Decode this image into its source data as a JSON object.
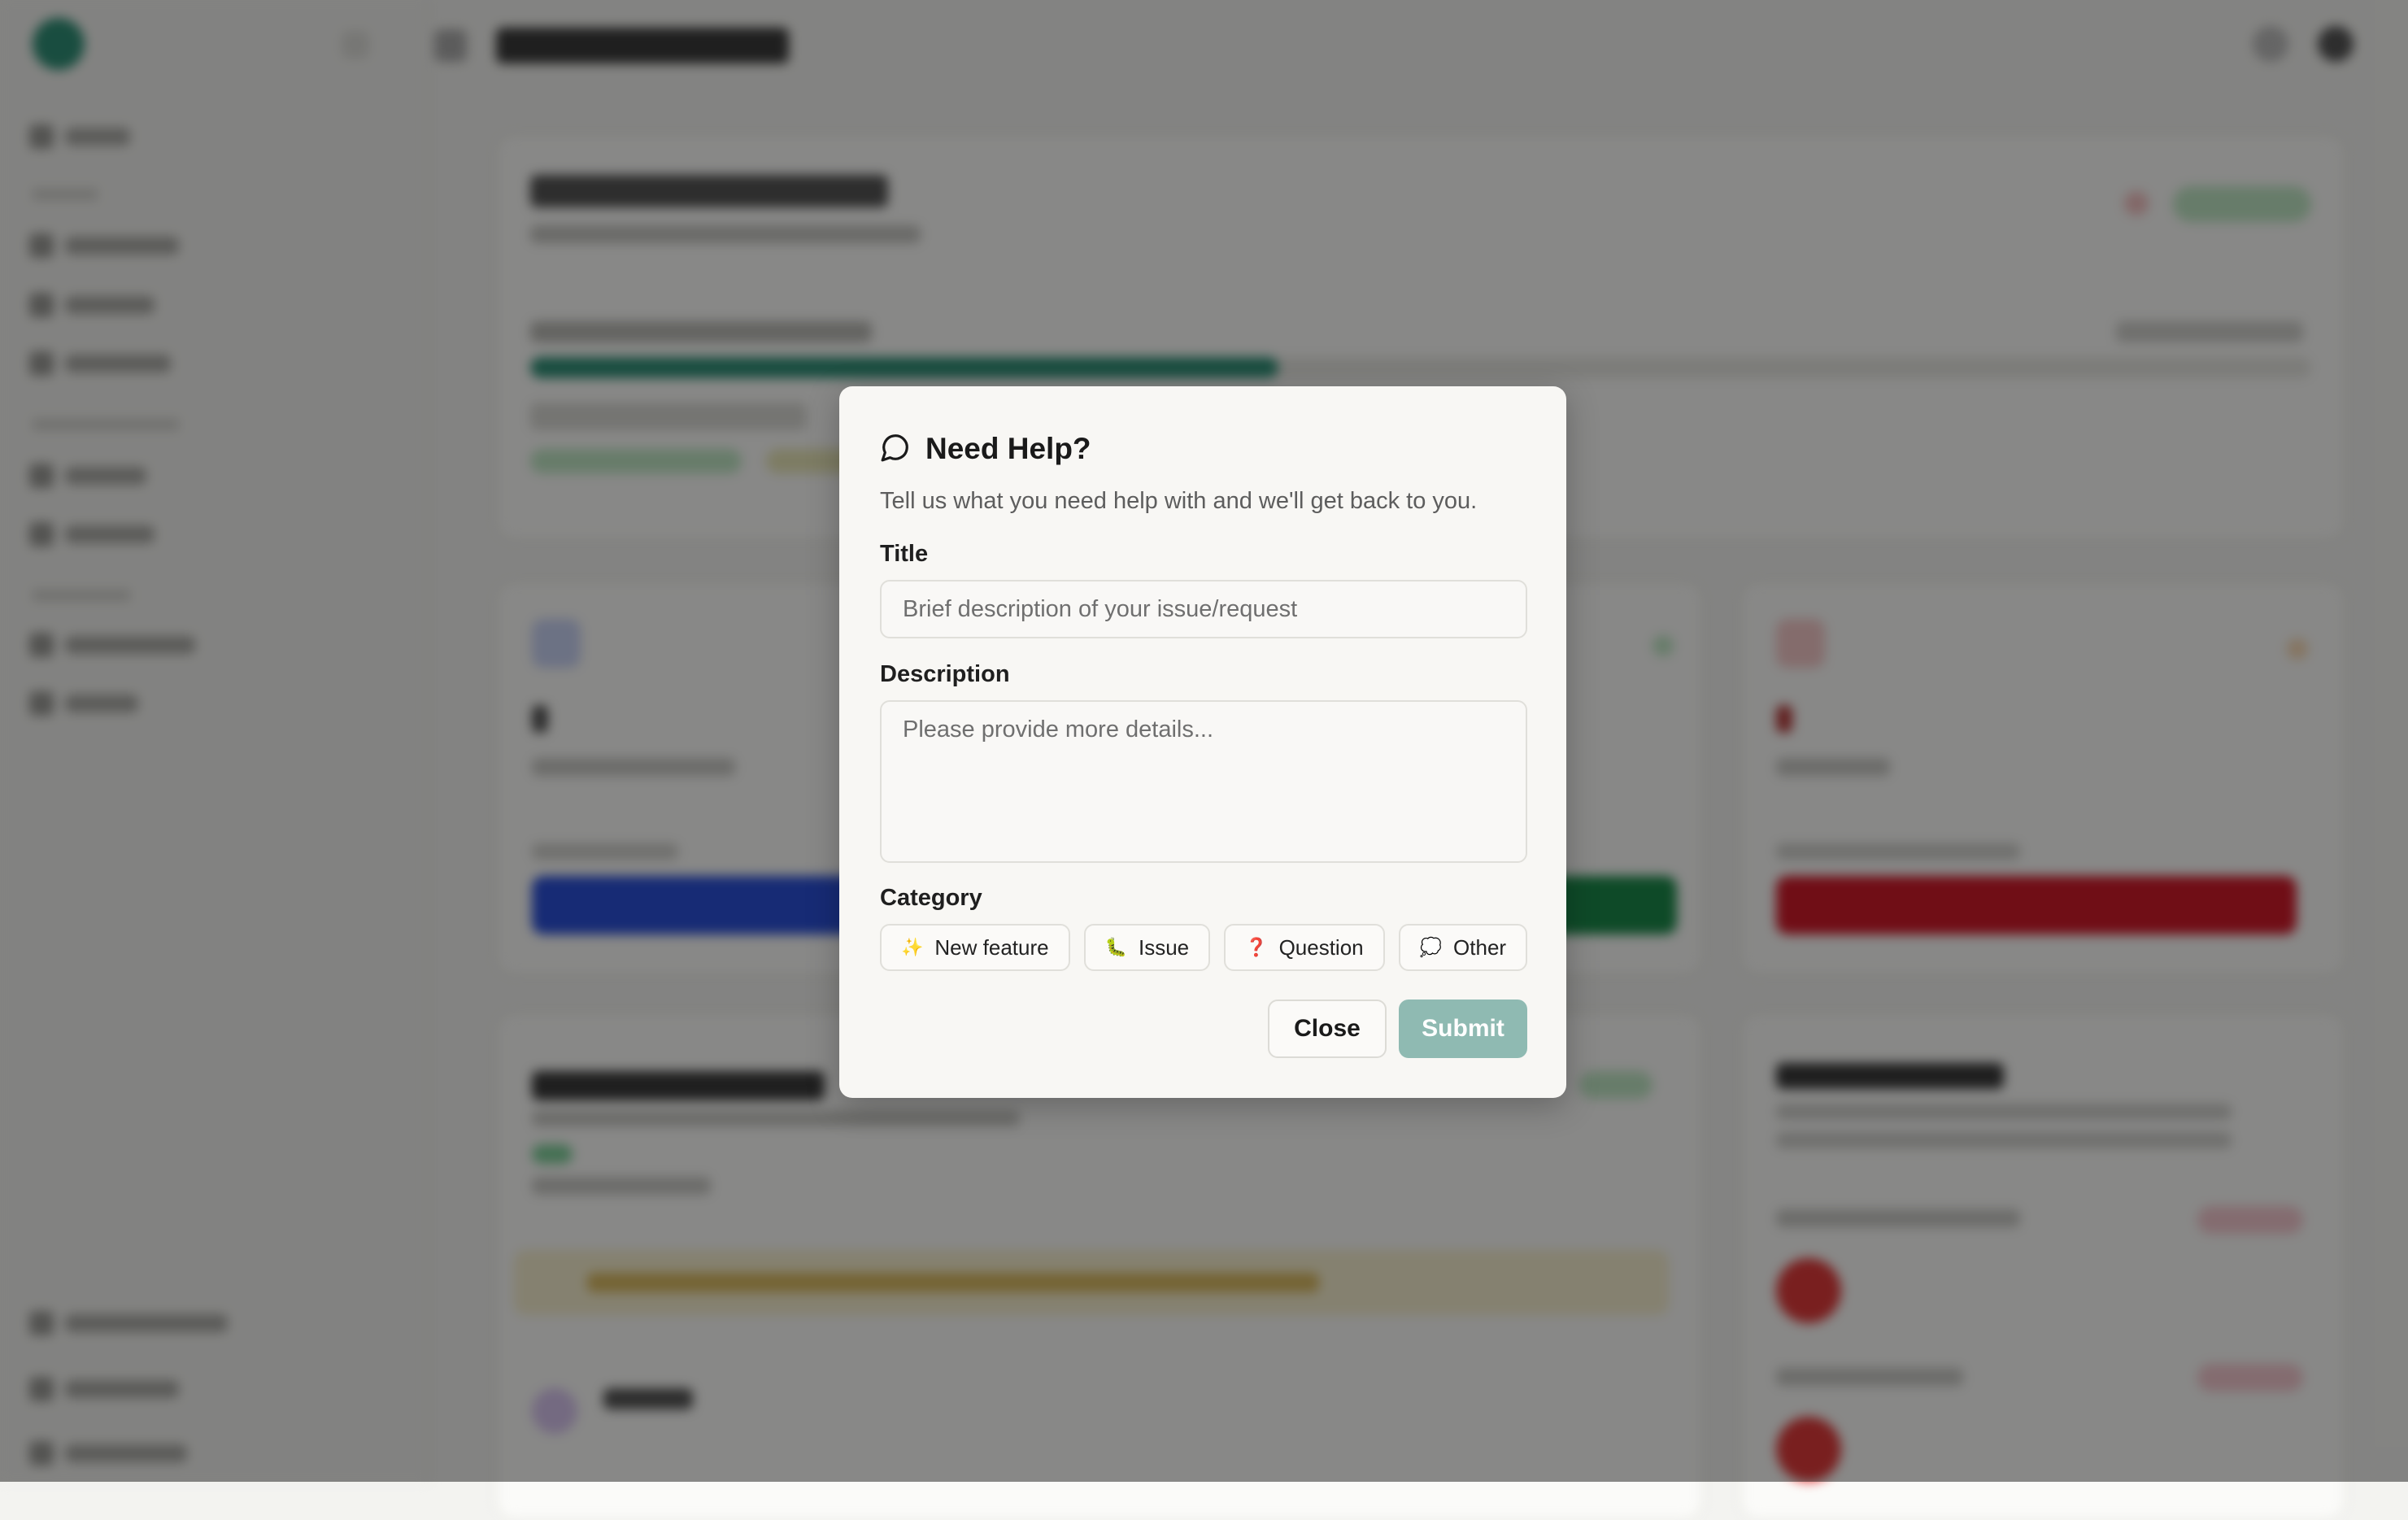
{
  "modal": {
    "title": "Need Help?",
    "description": "Tell us what you need help with and we'll get back to you.",
    "title_label": "Title",
    "title_placeholder": "Brief description of your issue/request",
    "description_label": "Description",
    "description_placeholder": "Please provide more details...",
    "category_label": "Category",
    "categories": [
      {
        "label": "New feature",
        "icon": "sparkles-icon",
        "glyph": "✨"
      },
      {
        "label": "Issue",
        "icon": "bug-icon",
        "glyph": "🐛"
      },
      {
        "label": "Question",
        "icon": "question-icon",
        "glyph": "❓"
      },
      {
        "label": "Other",
        "icon": "chat-bubble-icon",
        "glyph": "💭"
      }
    ],
    "close_label": "Close",
    "submit_label": "Submit"
  },
  "colors": {
    "accent": "#2f8f76",
    "submit_disabled": "#8fbab2",
    "overlay": "rgba(0,0,0,0.46)"
  }
}
